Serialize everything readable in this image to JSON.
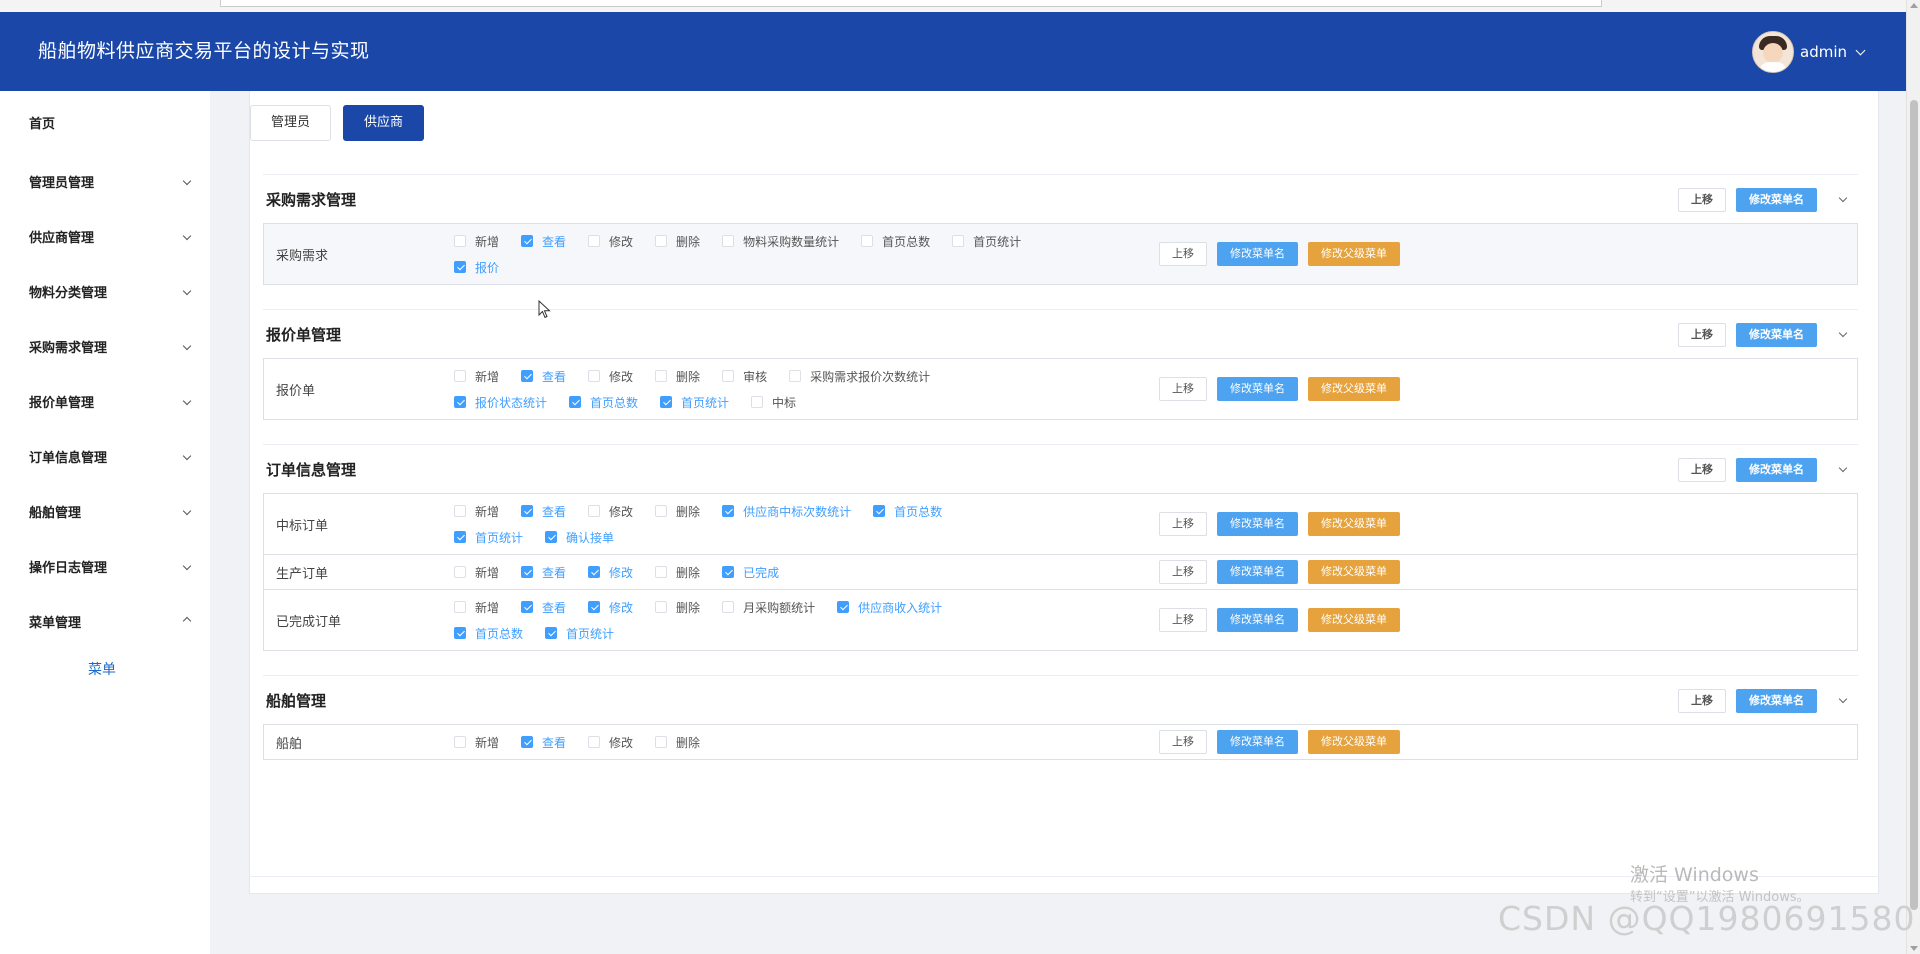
{
  "header": {
    "title": "船舶物料供应商交易平台的设计与实现",
    "username": "admin"
  },
  "sidebar": {
    "items": [
      {
        "label": "首页",
        "expandable": false
      },
      {
        "label": "管理员管理",
        "expandable": true
      },
      {
        "label": "供应商管理",
        "expandable": true
      },
      {
        "label": "物料分类管理",
        "expandable": true
      },
      {
        "label": "采购需求管理",
        "expandable": true
      },
      {
        "label": "报价单管理",
        "expandable": true
      },
      {
        "label": "订单信息管理",
        "expandable": true
      },
      {
        "label": "船舶管理",
        "expandable": true
      },
      {
        "label": "操作日志管理",
        "expandable": true
      },
      {
        "label": "菜单管理",
        "expandable": true,
        "expanded": true,
        "children": [
          "菜单"
        ]
      }
    ]
  },
  "tabs": [
    {
      "label": "管理员",
      "active": false
    },
    {
      "label": "供应商",
      "active": true
    }
  ],
  "buttons": {
    "move_up": "上移",
    "rename_menu": "修改菜单名",
    "change_parent": "修改父级菜单"
  },
  "sections": [
    {
      "title": "采购需求管理",
      "rows": [
        {
          "name": "采购需求",
          "highlighted": true,
          "perms": [
            {
              "label": "新增",
              "checked": false
            },
            {
              "label": "查看",
              "checked": true
            },
            {
              "label": "修改",
              "checked": false
            },
            {
              "label": "删除",
              "checked": false
            },
            {
              "label": "物料采购数量统计",
              "checked": false
            },
            {
              "label": "首页总数",
              "checked": false
            },
            {
              "label": "首页统计",
              "checked": false
            },
            {
              "label": "报价",
              "checked": true
            }
          ]
        }
      ]
    },
    {
      "title": "报价单管理",
      "rows": [
        {
          "name": "报价单",
          "highlighted": false,
          "perms": [
            {
              "label": "新增",
              "checked": false
            },
            {
              "label": "查看",
              "checked": true
            },
            {
              "label": "修改",
              "checked": false
            },
            {
              "label": "删除",
              "checked": false
            },
            {
              "label": "审核",
              "checked": false
            },
            {
              "label": "采购需求报价次数统计",
              "checked": false
            },
            {
              "label": "报价状态统计",
              "checked": true
            },
            {
              "label": "首页总数",
              "checked": true
            },
            {
              "label": "首页统计",
              "checked": true
            },
            {
              "label": "中标",
              "checked": false
            }
          ]
        }
      ]
    },
    {
      "title": "订单信息管理",
      "rows": [
        {
          "name": "中标订单",
          "highlighted": false,
          "perms": [
            {
              "label": "新增",
              "checked": false
            },
            {
              "label": "查看",
              "checked": true
            },
            {
              "label": "修改",
              "checked": false
            },
            {
              "label": "删除",
              "checked": false
            },
            {
              "label": "供应商中标次数统计",
              "checked": true
            },
            {
              "label": "首页总数",
              "checked": true
            },
            {
              "label": "首页统计",
              "checked": true
            },
            {
              "label": "确认接单",
              "checked": true
            }
          ]
        },
        {
          "name": "生产订单",
          "highlighted": false,
          "perms": [
            {
              "label": "新增",
              "checked": false
            },
            {
              "label": "查看",
              "checked": true
            },
            {
              "label": "修改",
              "checked": true
            },
            {
              "label": "删除",
              "checked": false
            },
            {
              "label": "已完成",
              "checked": true
            }
          ]
        },
        {
          "name": "已完成订单",
          "highlighted": false,
          "perms": [
            {
              "label": "新增",
              "checked": false
            },
            {
              "label": "查看",
              "checked": true
            },
            {
              "label": "修改",
              "checked": true
            },
            {
              "label": "删除",
              "checked": false
            },
            {
              "label": "月采购额统计",
              "checked": false
            },
            {
              "label": "供应商收入统计",
              "checked": true
            },
            {
              "label": "首页总数",
              "checked": true
            },
            {
              "label": "首页统计",
              "checked": true
            }
          ]
        }
      ]
    },
    {
      "title": "船舶管理",
      "rows": [
        {
          "name": "船舶",
          "highlighted": false,
          "perms": [
            {
              "label": "新增",
              "checked": false
            },
            {
              "label": "查看",
              "checked": true
            },
            {
              "label": "修改",
              "checked": false
            },
            {
              "label": "删除",
              "checked": false
            }
          ]
        }
      ]
    }
  ],
  "watermarks": {
    "activate_title": "激活 Windows",
    "activate_sub": "转到“设置”以激活 Windows。",
    "csdn": "CSDN @QQ1980691580"
  },
  "colors": {
    "header_bg": "#1a47a8",
    "primary": "#409eff",
    "blue_button": "#4da3f0",
    "orange_button": "#e6a23c"
  }
}
